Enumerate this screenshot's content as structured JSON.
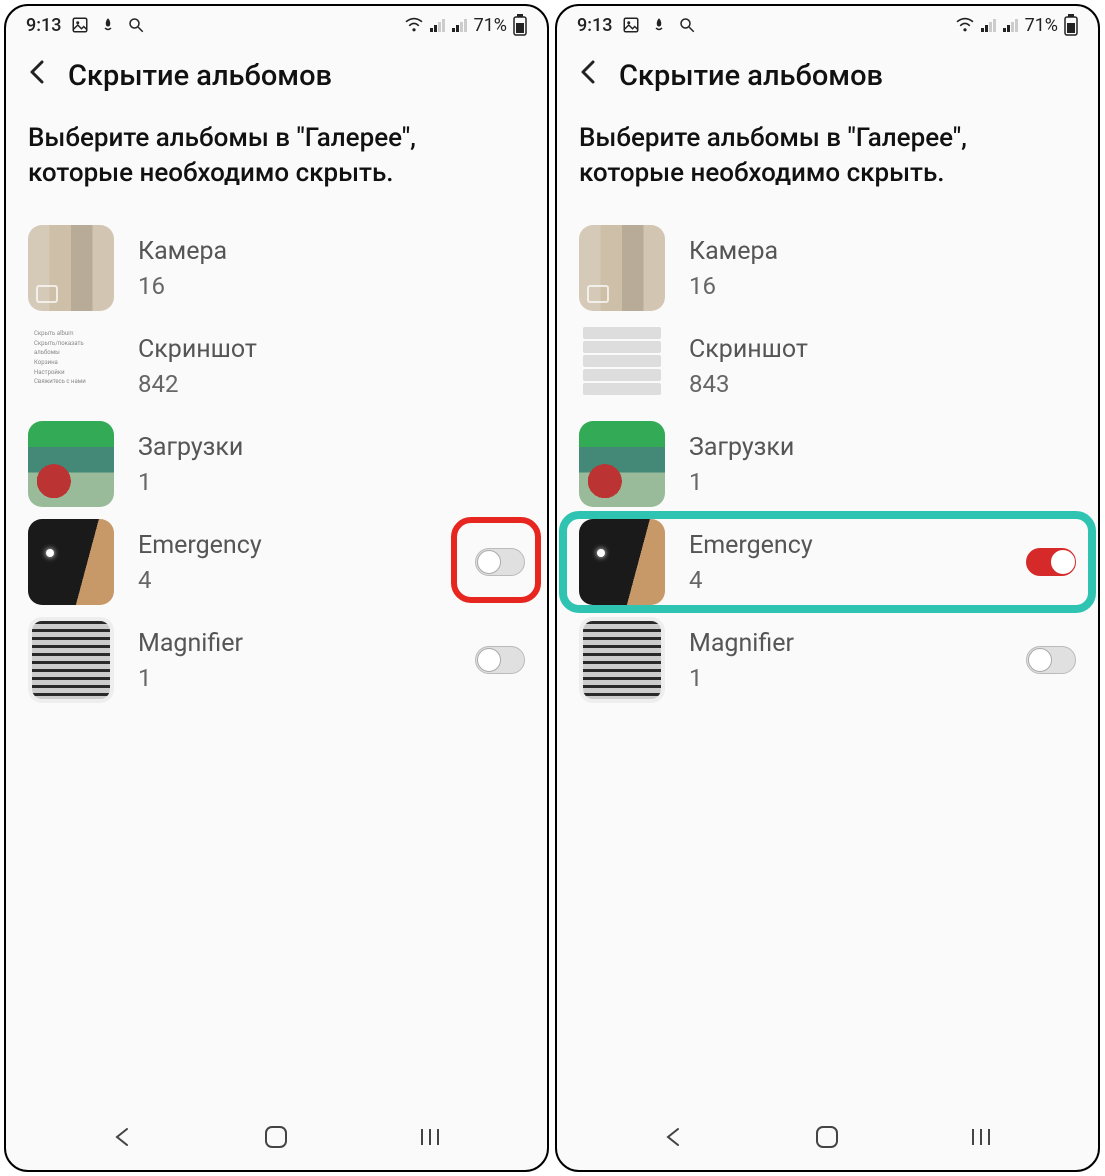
{
  "status": {
    "time": "9:13",
    "battery": "71%"
  },
  "header": {
    "title": "Скрытие альбомов"
  },
  "subtitle": "Выберите альбомы в \"Галерее\", которые необходимо скрыть.",
  "left": {
    "albums": [
      {
        "name": "Камера",
        "count": "16",
        "toggle": null,
        "thumb": "camera"
      },
      {
        "name": "Скриншот",
        "count": "842",
        "toggle": null,
        "thumb": "screenshot"
      },
      {
        "name": "Загрузки",
        "count": "1",
        "toggle": null,
        "thumb": "downloads"
      },
      {
        "name": "Emergency",
        "count": "4",
        "toggle": false,
        "thumb": "emergency",
        "highlight": "red-toggle"
      },
      {
        "name": "Magnifier",
        "count": "1",
        "toggle": false,
        "thumb": "magnifier"
      }
    ]
  },
  "right": {
    "albums": [
      {
        "name": "Камера",
        "count": "16",
        "toggle": null,
        "thumb": "camera"
      },
      {
        "name": "Скриншот",
        "count": "843",
        "toggle": null,
        "thumb": "screenshot2"
      },
      {
        "name": "Загрузки",
        "count": "1",
        "toggle": null,
        "thumb": "downloads"
      },
      {
        "name": "Emergency",
        "count": "4",
        "toggle": true,
        "thumb": "emergency",
        "highlight": "teal-row"
      },
      {
        "name": "Magnifier",
        "count": "1",
        "toggle": false,
        "thumb": "magnifier"
      }
    ]
  }
}
